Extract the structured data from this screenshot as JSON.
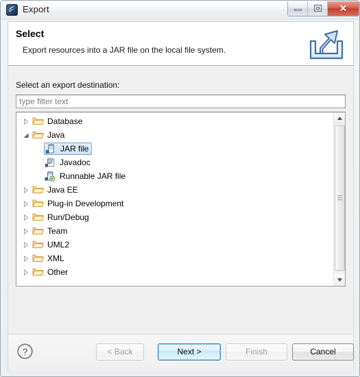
{
  "window": {
    "title": "Export",
    "app_icon": "eclipse-icon",
    "controls": [
      {
        "name": "minimize",
        "glyph": "minimize-icon"
      },
      {
        "name": "maximize",
        "glyph": "restore-icon"
      },
      {
        "name": "close",
        "glyph": "close-icon",
        "label": "✕",
        "color": "#c33f2c"
      }
    ]
  },
  "header": {
    "title": "Select",
    "description": "Export resources into a JAR file on the local file system.",
    "icon": "export-wizard-icon"
  },
  "body": {
    "field_label": "Select an export destination:",
    "filter": {
      "placeholder": "type filter text",
      "value": ""
    }
  },
  "tree": {
    "items": [
      {
        "label": "Database",
        "indent": 0,
        "state": "collapsed",
        "icon": "folder-icon",
        "selected": false
      },
      {
        "label": "Java",
        "indent": 0,
        "state": "expanded",
        "icon": "folder-icon",
        "selected": false
      },
      {
        "label": "JAR file",
        "indent": 1,
        "state": "leaf",
        "icon": "jar-file-icon",
        "selected": true
      },
      {
        "label": "Javadoc",
        "indent": 1,
        "state": "leaf",
        "icon": "javadoc-icon",
        "selected": false
      },
      {
        "label": "Runnable JAR file",
        "indent": 1,
        "state": "leaf",
        "icon": "runnable-jar-file-icon",
        "selected": false
      },
      {
        "label": "Java EE",
        "indent": 0,
        "state": "collapsed",
        "icon": "folder-icon",
        "selected": false
      },
      {
        "label": "Plug-in Development",
        "indent": 0,
        "state": "collapsed",
        "icon": "folder-icon",
        "selected": false
      },
      {
        "label": "Run/Debug",
        "indent": 0,
        "state": "collapsed",
        "icon": "folder-icon",
        "selected": false
      },
      {
        "label": "Team",
        "indent": 0,
        "state": "collapsed",
        "icon": "folder-icon",
        "selected": false
      },
      {
        "label": "UML2",
        "indent": 0,
        "state": "collapsed",
        "icon": "folder-icon",
        "selected": false
      },
      {
        "label": "XML",
        "indent": 0,
        "state": "collapsed",
        "icon": "folder-icon",
        "selected": false
      },
      {
        "label": "Other",
        "indent": 0,
        "state": "collapsed",
        "icon": "folder-icon",
        "selected": false
      }
    ],
    "twisty_collapsed": "▷",
    "twisty_expanded": "◢",
    "scrollbar": {
      "up_arrow": "▲",
      "down_arrow": "▼"
    }
  },
  "buttons": {
    "help": {
      "label": "?",
      "name": "help-icon"
    },
    "back": {
      "label": "< Back",
      "enabled": false
    },
    "next": {
      "label": "Next >",
      "enabled": true,
      "default": true
    },
    "finish": {
      "label": "Finish",
      "enabled": false
    },
    "cancel": {
      "label": "Cancel",
      "enabled": true
    }
  },
  "colors": {
    "selection_fill": "#cfe4f7",
    "selection_border": "#7da2ce",
    "default_button_border": "#3c7fb1",
    "close_button": "#c33f2c",
    "folder": "#f5c87a"
  }
}
